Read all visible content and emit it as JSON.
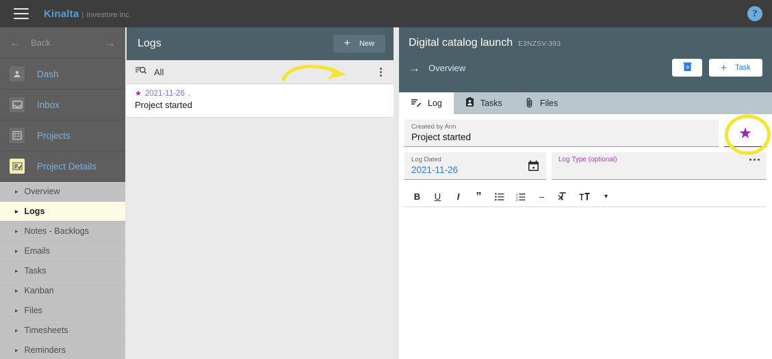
{
  "topbar": {
    "menu_icon": "hamburger-icon",
    "brand": "Kinalta",
    "separator": "|",
    "subtitle": "Investore inc.",
    "help_icon": "?"
  },
  "sidebar": {
    "back": {
      "label": "Back",
      "left_icon": "arrow-left-icon",
      "right_icon": "arrow-right-icon"
    },
    "items": [
      {
        "label": "Dash",
        "icon": "contact-card-icon",
        "active": false
      },
      {
        "label": "Inbox",
        "icon": "inbox-tray-icon",
        "active": false
      },
      {
        "label": "Projects",
        "icon": "list-grid-icon",
        "active": false
      },
      {
        "label": "Project Details",
        "icon": "checklist-icon",
        "active": true
      }
    ],
    "subitems": [
      {
        "label": "Overview",
        "selected": false
      },
      {
        "label": "Logs",
        "selected": true
      },
      {
        "label": "Notes - Backlogs",
        "selected": false
      },
      {
        "label": "Emails",
        "selected": false
      },
      {
        "label": "Tasks",
        "selected": false
      },
      {
        "label": "Kanban",
        "selected": false
      },
      {
        "label": "Files",
        "selected": false
      },
      {
        "label": "Timesheets",
        "selected": false
      },
      {
        "label": "Reminders",
        "selected": false
      }
    ]
  },
  "mid_panel": {
    "title": "Logs",
    "new_button": {
      "label": "New",
      "icon": "plus-icon"
    },
    "filter": {
      "icon": "filter-search-icon",
      "label": "All",
      "menu_icon": "kebab-menu-icon"
    },
    "logs": [
      {
        "star": "★",
        "date": "2021-11-26",
        "dot": ".",
        "title": "Project started"
      }
    ]
  },
  "right_panel": {
    "project_title": "Digital catalog launch",
    "project_code": "E3NZSV-393",
    "overview_link": {
      "label": "Overview",
      "icon": "arrow-right-icon"
    },
    "buttons": {
      "delete": {
        "icon": "trash-icon",
        "label": ""
      },
      "task": {
        "label": "Task",
        "icon": "plus-icon"
      }
    },
    "tabs": [
      {
        "label": "Log",
        "icon": "log-lines-pencil-icon",
        "active": true
      },
      {
        "label": "Tasks",
        "icon": "clipboard-icon",
        "active": false
      },
      {
        "label": "Files",
        "icon": "paperclip-icon",
        "active": false
      }
    ],
    "form": {
      "created_by_label": "Created by Ann",
      "created_by_value": "Project started",
      "favorite_star": "★",
      "log_dated_label": "Log Dated",
      "log_dated_value": "2021-11-26",
      "calendar_icon": "calendar-icon",
      "log_type_label": "Log Type (optional)",
      "log_type_value": "",
      "more_icon": "more-horizontal-icon"
    },
    "editor_toolbar": [
      {
        "name": "bold",
        "glyph": "B"
      },
      {
        "name": "underline",
        "glyph": "U"
      },
      {
        "name": "italic",
        "glyph": "I"
      },
      {
        "name": "quote",
        "glyph": "”"
      },
      {
        "name": "bullet-list",
        "glyph": "☰"
      },
      {
        "name": "numbered-list",
        "glyph": "☰"
      },
      {
        "name": "horizontal-rule",
        "glyph": "–"
      },
      {
        "name": "clear-format",
        "glyph": "✕"
      },
      {
        "name": "font-size",
        "glyph": "ᴛᴛ"
      },
      {
        "name": "dropdown",
        "glyph": "▾"
      }
    ]
  },
  "annotations": {
    "arrow_color": "#f5e433",
    "ellipse_color": "#f5e433",
    "arrow_target": "new-button",
    "ellipse_target": "favorite-star-button"
  },
  "colors": {
    "topbar": "#3d3d3d",
    "sidebar": "#5e5e5e",
    "panel_header": "#4c6069",
    "accent_blue": "#2a7ade",
    "accent_purple": "#9b27b0",
    "highlight_yellow": "#fdfbe3"
  }
}
